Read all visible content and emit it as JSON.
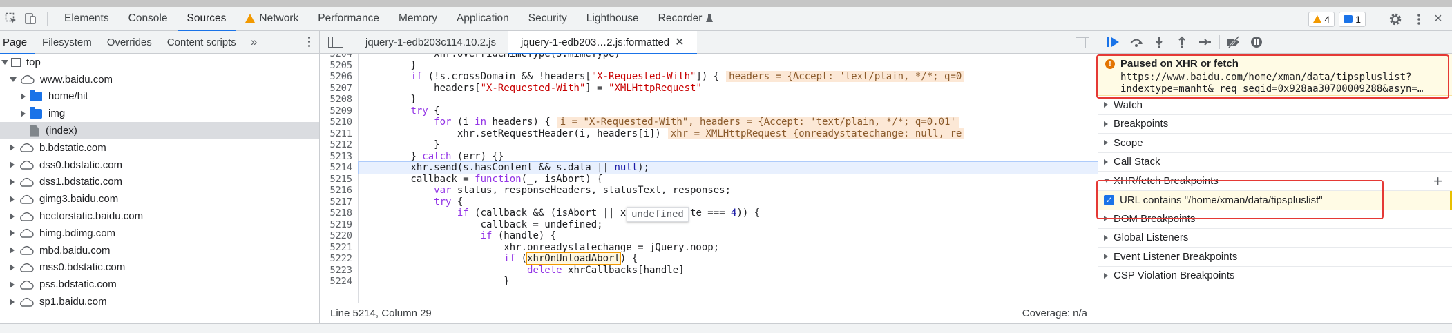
{
  "main_tabs": [
    {
      "label": "Elements"
    },
    {
      "label": "Console"
    },
    {
      "label": "Sources"
    },
    {
      "label": "Network"
    },
    {
      "label": "Performance"
    },
    {
      "label": "Memory"
    },
    {
      "label": "Application"
    },
    {
      "label": "Security"
    },
    {
      "label": "Lighthouse"
    },
    {
      "label": "Recorder"
    }
  ],
  "badges": {
    "warnings": "4",
    "messages": "1"
  },
  "navigator": {
    "tabs": [
      "Page",
      "Filesystem",
      "Overrides",
      "Content scripts"
    ],
    "more": "»",
    "tree": [
      {
        "label": "top",
        "kind": "frame",
        "indent": 0,
        "expanded": true
      },
      {
        "label": "www.baidu.com",
        "kind": "domain",
        "indent": 1,
        "expanded": true
      },
      {
        "label": "home/hit",
        "kind": "folder",
        "indent": 2,
        "expanded": false
      },
      {
        "label": "img",
        "kind": "folder",
        "indent": 2,
        "expanded": false
      },
      {
        "label": "(index)",
        "kind": "file",
        "indent": 2,
        "selected": true
      },
      {
        "label": "b.bdstatic.com",
        "kind": "domain",
        "indent": 1
      },
      {
        "label": "dss0.bdstatic.com",
        "kind": "domain",
        "indent": 1
      },
      {
        "label": "dss1.bdstatic.com",
        "kind": "domain",
        "indent": 1
      },
      {
        "label": "gimg3.baidu.com",
        "kind": "domain",
        "indent": 1
      },
      {
        "label": "hectorstatic.baidu.com",
        "kind": "domain",
        "indent": 1
      },
      {
        "label": "himg.bdimg.com",
        "kind": "domain",
        "indent": 1
      },
      {
        "label": "mbd.baidu.com",
        "kind": "domain",
        "indent": 1
      },
      {
        "label": "mss0.bdstatic.com",
        "kind": "domain",
        "indent": 1
      },
      {
        "label": "pss.bdstatic.com",
        "kind": "domain",
        "indent": 1
      },
      {
        "label": "sp1.baidu.com",
        "kind": "domain",
        "indent": 1
      }
    ]
  },
  "editor": {
    "tabs": [
      {
        "label": "jquery-1-edb203c114.10.2.js",
        "active": false
      },
      {
        "label": "jquery-1-edb203…2.js:formatted",
        "active": true
      }
    ],
    "first_line": 5204,
    "exec_line": 5214,
    "code": [
      "            xhr.overrideMimeType(s.mimeType)",
      "        }",
      "        if (!s.crossDomain && !headers[\"X-Requested-With\"]) {",
      "            headers[\"X-Requested-With\"] = \"XMLHttpRequest\"",
      "        }",
      "        try {",
      "            for (i in headers) {",
      "                xhr.setRequestHeader(i, headers[i])",
      "            }",
      "        } catch (err) {}",
      "        xhr.send(s.hasContent && s.data || null);",
      "        callback = function(_, isAbort) {",
      "            var status, responseHeaders, statusText, responses;",
      "            try {",
      "                if (callback && (isAbort || xhr.readyState === 4)) {",
      "                    callback = undefined;",
      "                    if (handle) {",
      "                        xhr.onreadystatechange = jQuery.noop;",
      "                        if (xhrOnUnloadAbort) {",
      "                            delete xhrCallbacks[handle]",
      "                        }"
    ],
    "inline_values": [
      {
        "line": 5206,
        "text": "headers = {Accept: 'text/plain, */*; q=0"
      },
      {
        "line": 5210,
        "text": "i = \"X-Requested-With\", headers = {Accept: 'text/plain, */*; q=0.01'"
      },
      {
        "line": 5211,
        "text": "xhr = XMLHttpRequest {onreadystatechange: null, re"
      }
    ],
    "tooltip": "undefined",
    "status_left": "Line 5214, Column 29",
    "status_right": "Coverage: n/a"
  },
  "debugger": {
    "paused_title": "Paused on XHR or fetch",
    "paused_url_1": "https://www.baidu.com/home/xman/data/tipspluslist?",
    "paused_url_2": "indextype=manht&_req_seqid=0x928aa30700009288&asyn=…",
    "sections_top": [
      "Watch",
      "Breakpoints",
      "Scope",
      "Call Stack"
    ],
    "xhr_section": "XHR/fetch Breakpoints",
    "xhr_breakpoint": "URL contains \"/home/xman/data/tipspluslist\"",
    "sections_bottom": [
      "DOM Breakpoints",
      "Global Listeners",
      "Event Listener Breakpoints",
      "CSP Violation Breakpoints"
    ]
  },
  "colors": {
    "accent": "#1a73e8",
    "highlight_box": "#e53935",
    "paused_bg": "#fffbe5"
  }
}
